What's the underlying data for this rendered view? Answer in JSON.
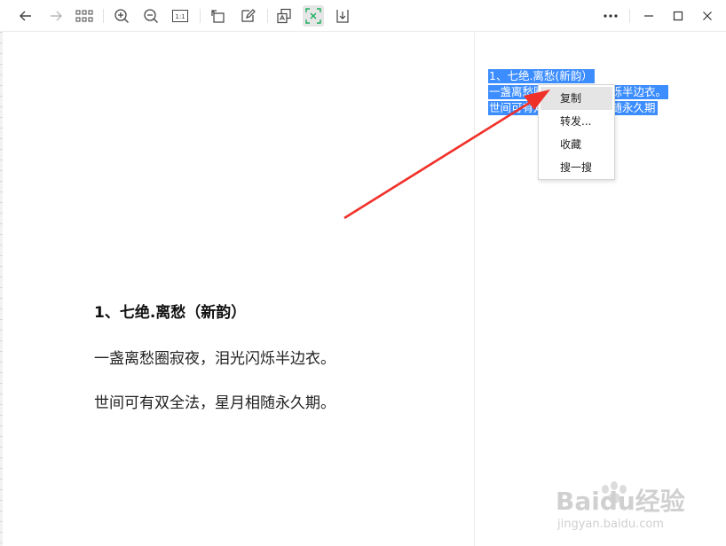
{
  "toolbar": {
    "buttons": [
      {
        "icon": "back-arrow-icon"
      },
      {
        "icon": "forward-arrow-icon"
      },
      {
        "icon": "grid-icon"
      },
      {
        "icon": "zoom-in-icon"
      },
      {
        "icon": "zoom-out-icon"
      },
      {
        "icon": "actual-size-icon",
        "label": "1:1"
      },
      {
        "icon": "rotate-icon"
      },
      {
        "icon": "edit-icon"
      },
      {
        "icon": "translate-icon"
      },
      {
        "icon": "ocr-text-icon",
        "active": true
      },
      {
        "icon": "download-icon"
      }
    ],
    "window": [
      {
        "icon": "more-icon"
      },
      {
        "icon": "minimize-icon"
      },
      {
        "icon": "maximize-icon"
      },
      {
        "icon": "close-icon"
      }
    ]
  },
  "image": {
    "title": "1、七绝.离愁（新韵）",
    "lines": [
      "一盏离愁圈寂夜，泪光闪烁半边衣。",
      "世间可有双全法，星月相随永久期。"
    ]
  },
  "ocr": {
    "lines": [
      "1、七绝.离愁(新韵）",
      "一盏离愁圈寂夜，泪光闪烁半边衣。",
      "世间可有双全法，星月相随永久期"
    ],
    "highlight_color": "#3c8dff"
  },
  "context_menu": {
    "items": [
      "复制",
      "转发...",
      "收藏",
      "搜一搜"
    ],
    "highlighted_index": 0
  },
  "annotation": {
    "arrow_color": "#f0312a"
  },
  "watermark": {
    "brand": "Baidu经验",
    "url": "jingyan.baidu.com"
  }
}
